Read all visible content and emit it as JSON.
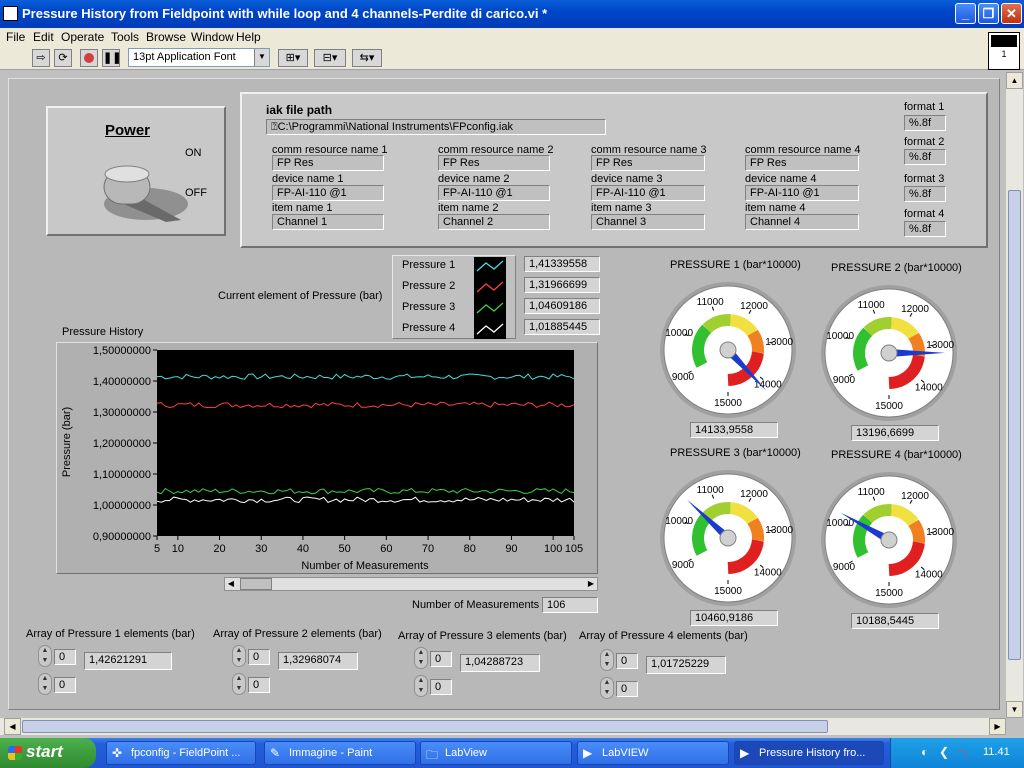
{
  "window": {
    "title": "Pressure History from Fieldpoint with while loop and 4 channels-Perdite di carico.vi *"
  },
  "menu": [
    "File",
    "Edit",
    "Operate",
    "Tools",
    "Browse",
    "Window",
    "Help"
  ],
  "toolbar": {
    "font": "13pt Application Font",
    "run_indicator": "1"
  },
  "power": {
    "label": "Power",
    "on": "ON",
    "off": "OFF"
  },
  "config": {
    "iak_label": "iak file path",
    "iak_path": "C:\\Programmi\\National Instruments\\FPconfig.iak",
    "channels": [
      {
        "comm_label": "comm resource name 1",
        "comm": "FP Res",
        "dev_label": "device name 1",
        "dev": "FP-AI-110 @1",
        "item_label": "item name 1",
        "item": "Channel 1"
      },
      {
        "comm_label": "comm resource name 2",
        "comm": "FP Res",
        "dev_label": "device name 2",
        "dev": "FP-AI-110 @1",
        "item_label": "item name 2",
        "item": "Channel 2"
      },
      {
        "comm_label": "comm resource name 3",
        "comm": "FP Res",
        "dev_label": "device name 3",
        "dev": "FP-AI-110 @1",
        "item_label": "item name 3",
        "item": "Channel 3"
      },
      {
        "comm_label": "comm resource name 4",
        "comm": "FP Res",
        "dev_label": "device name 4",
        "dev": "FP-AI-110 @1",
        "item_label": "item name 4",
        "item": "Channel 4"
      }
    ],
    "formats": [
      {
        "label": "format 1",
        "value": "%.8f"
      },
      {
        "label": "format 2",
        "value": "%.8f"
      },
      {
        "label": "format 3",
        "value": "%.8f"
      },
      {
        "label": "format 4",
        "value": "%.8f"
      }
    ]
  },
  "current": {
    "label": "Current element of Pressure  (bar)",
    "items": [
      {
        "name": "Pressure 1",
        "value": "1,41339558",
        "color": "#40e0e0"
      },
      {
        "name": "Pressure 2",
        "value": "1,31966699",
        "color": "#ff4040"
      },
      {
        "name": "Pressure 3",
        "value": "1,04609186",
        "color": "#40d040"
      },
      {
        "name": "Pressure 4",
        "value": "1,01885445",
        "color": "#ffffff"
      }
    ]
  },
  "graph": {
    "title": "Pressure History",
    "ylabel": "Pressure (bar)",
    "xlabel": "Number of Measurements",
    "yticks": [
      "1,50000000",
      "1,40000000",
      "1,30000000",
      "1,20000000",
      "1,10000000",
      "1,00000000",
      "0,90000000"
    ],
    "xticks": [
      "5",
      "10",
      "20",
      "30",
      "40",
      "50",
      "60",
      "70",
      "80",
      "90",
      "100",
      "105"
    ]
  },
  "chart_data": {
    "type": "line",
    "title": "Pressure History",
    "xlabel": "Number of Measurements",
    "ylabel": "Pressure (bar)",
    "xlim": [
      5,
      105
    ],
    "ylim": [
      0.9,
      1.5
    ],
    "series": [
      {
        "name": "Pressure 1",
        "color": "#40e0e0",
        "approx_level": 1.414
      },
      {
        "name": "Pressure 2",
        "color": "#ff4040",
        "approx_level": 1.323
      },
      {
        "name": "Pressure 3",
        "color": "#40d040",
        "approx_level": 1.045
      },
      {
        "name": "Pressure 4",
        "color": "#ffffff",
        "approx_level": 1.017
      }
    ]
  },
  "measurements": {
    "label": "Number of Measurements",
    "value": "106"
  },
  "gauges": [
    {
      "title": "PRESSURE 1 (bar*10000)",
      "value": "14133,9558",
      "num": 14134
    },
    {
      "title": "PRESSURE 2 (bar*10000)",
      "value": "13196,6699",
      "num": 13197
    },
    {
      "title": "PRESSURE 3 (bar*10000)",
      "value": "10460,9186",
      "num": 10461
    },
    {
      "title": "PRESSURE 4 (bar*10000)",
      "value": "10188,5445",
      "num": 10189
    }
  ],
  "gauge_ticks": [
    "9000",
    "10000",
    "11000",
    "12000",
    "13000",
    "14000",
    "15000"
  ],
  "arrays": [
    {
      "label": "Array of Pressure 1 elements (bar)",
      "idx1": "0",
      "idx2": "0",
      "value": "1,42621291"
    },
    {
      "label": "Array of Pressure 2 elements (bar)",
      "idx1": "0",
      "idx2": "0",
      "value": "1,32968074"
    },
    {
      "label": "Array of Pressure 3 elements (bar)",
      "idx1": "0",
      "idx2": "0",
      "value": "1,04288723"
    },
    {
      "label": "Array of Pressure 4 elements (bar)",
      "idx1": "0",
      "idx2": "0",
      "value": "1,01725229"
    }
  ],
  "taskbar": {
    "start": "start",
    "tasks": [
      "fpconfig - FieldPoint ...",
      "Immagine - Paint",
      "LabView",
      "LabVIEW",
      "Pressure History fro..."
    ],
    "lang": "IT",
    "clock": "11.41"
  }
}
